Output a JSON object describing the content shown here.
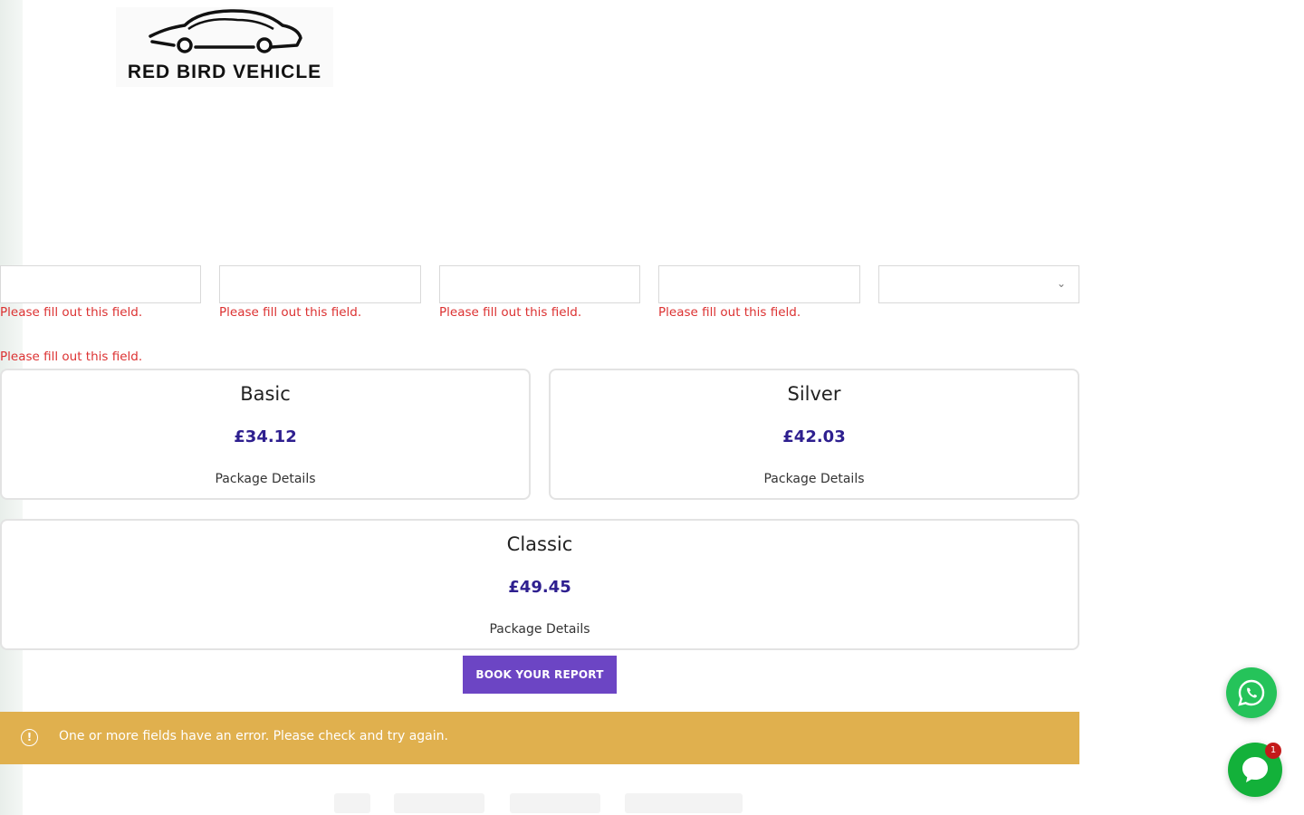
{
  "brand": {
    "name": "RED BIRD VEHICLE"
  },
  "form": {
    "error_message": "Please fill out this field.",
    "fields": [
      {
        "id": "field-1",
        "value": ""
      },
      {
        "id": "field-2",
        "value": ""
      },
      {
        "id": "field-3",
        "value": ""
      },
      {
        "id": "field-4",
        "value": ""
      }
    ],
    "select": {
      "value": ""
    }
  },
  "packages": [
    {
      "name": "Basic",
      "price": "£34.12",
      "details_label": "Package Details"
    },
    {
      "name": "Silver",
      "price": "£42.03",
      "details_label": "Package Details"
    },
    {
      "name": "Classic",
      "price": "£49.45",
      "details_label": "Package Details"
    }
  ],
  "book_button": {
    "label": "BOOK YOUR REPORT"
  },
  "alert": {
    "icon": "info-circle-icon",
    "text": "One or more fields have an error. Please check and try again.",
    "color": "#e0b04e"
  },
  "floating": {
    "whatsapp_icon": "whatsapp-icon",
    "chat_icon": "chat-bubble-icon",
    "chat_badge_count": "1"
  },
  "colors": {
    "accent": "#6c45c4",
    "price": "#2e1f8f",
    "error": "#dc3232",
    "whatsapp": "#25c35a"
  }
}
